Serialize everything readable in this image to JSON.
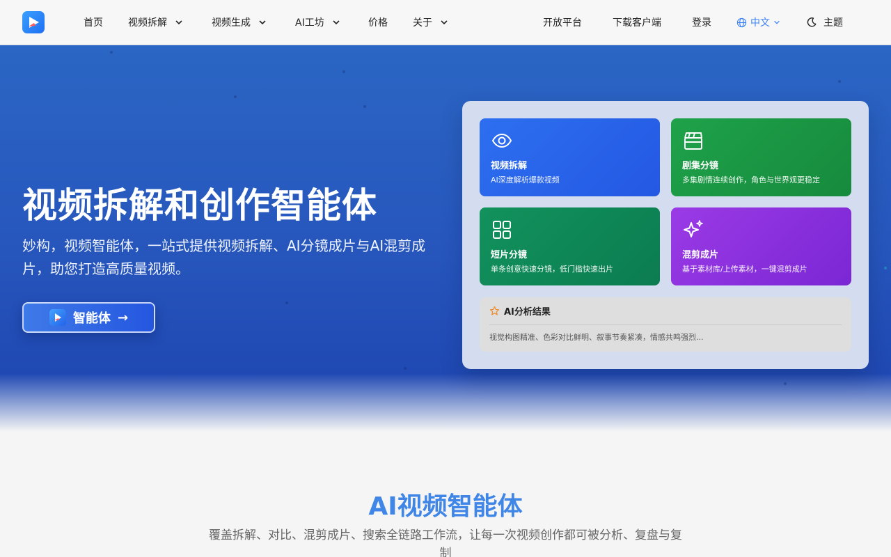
{
  "nav": {
    "items": [
      {
        "label": "首页"
      },
      {
        "label": "视频拆解"
      },
      {
        "label": "视频生成"
      },
      {
        "label": "AI工坊"
      },
      {
        "label": "价格"
      },
      {
        "label": "关于"
      }
    ],
    "right": {
      "open_platform": "开放平台",
      "download": "下载客户端",
      "login": "登录",
      "language": "中文",
      "theme": "主题"
    }
  },
  "hero": {
    "title": "视频拆解和创作智能体",
    "subtitle": "妙构，视频智能体，一站式提供视频拆解、AI分镜成片与AI混剪成片，助您打造高质量视频。",
    "cta_label": "智能体",
    "cta_arrow": "→"
  },
  "panel": {
    "cards": [
      {
        "title": "视频拆解",
        "desc": "AI深度解析爆款视频",
        "icon": "eye-icon",
        "color": "#2d6ff0"
      },
      {
        "title": "剧集分镜",
        "desc": "多集剧情连续创作，角色与世界观更稳定",
        "icon": "clapperboard-icon",
        "color": "#1fa24a"
      },
      {
        "title": "短片分镜",
        "desc": "单条创意快速分镜，低门槛快速出片",
        "icon": "grid-icon",
        "color": "#12925d"
      },
      {
        "title": "混剪成片",
        "desc": "基于素材库/上传素材，一键混剪成片",
        "icon": "sparkles-icon",
        "color": "#9a3be6"
      }
    ],
    "result": {
      "title": "AI分析结果",
      "text": "视觉构图精准、色彩对比鲜明、叙事节奏紧凑，情感共鸣强烈..."
    }
  },
  "section": {
    "title": "AI视频智能体",
    "subtitle": "覆盖拆解、对比、混剪成片、搜索全链路工作流，让每一次视频创作都可被分析、复盘与复制"
  }
}
